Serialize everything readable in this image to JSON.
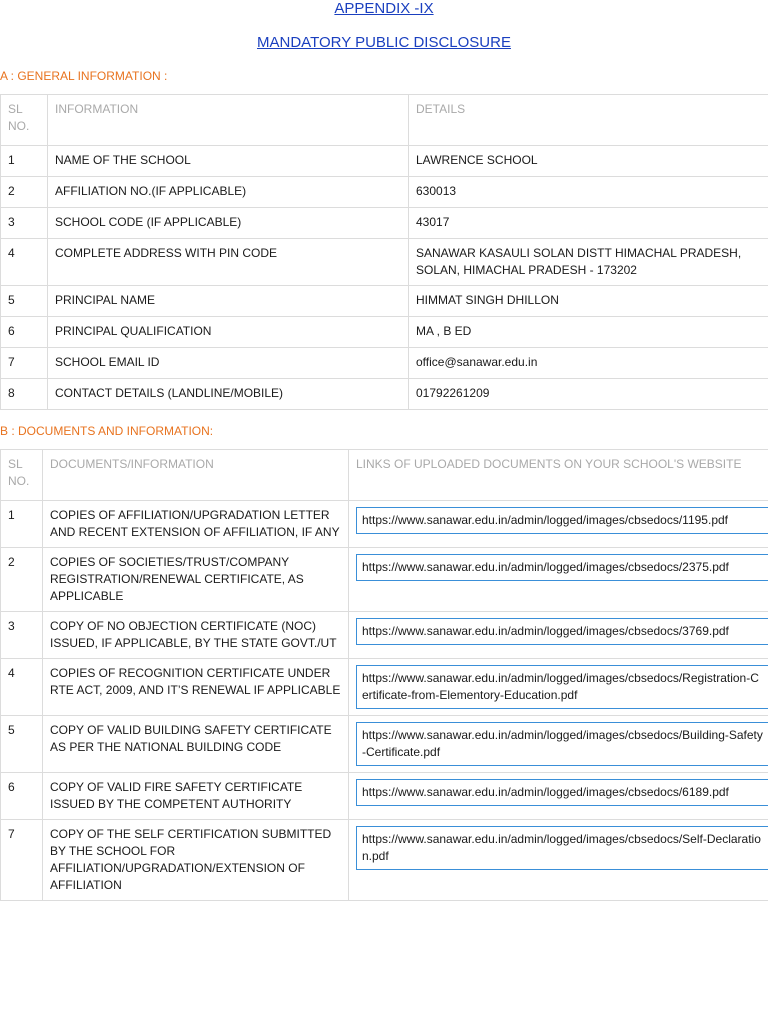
{
  "header": {
    "appendix": "APPENDIX -IX",
    "disclosure": "MANDATORY PUBLIC DISCLOSURE"
  },
  "section_a": {
    "heading": "A : GENERAL INFORMATION :",
    "columns": [
      "SL NO.",
      "INFORMATION",
      "DETAILS"
    ],
    "rows": [
      {
        "sl": "1",
        "info": "NAME OF THE SCHOOL",
        "details": "LAWRENCE SCHOOL"
      },
      {
        "sl": "2",
        "info": "AFFILIATION NO.(IF APPLICABLE)",
        "details": "630013"
      },
      {
        "sl": "3",
        "info": "SCHOOL CODE (IF APPLICABLE)",
        "details": "43017"
      },
      {
        "sl": "4",
        "info": "COMPLETE ADDRESS WITH PIN CODE",
        "details": "SANAWAR KASAULI SOLAN DISTT HIMACHAL PRADESH, SOLAN, HIMACHAL PRADESH - 173202"
      },
      {
        "sl": "5",
        "info": "PRINCIPAL NAME",
        "details": "HIMMAT SINGH DHILLON"
      },
      {
        "sl": "6",
        "info": "PRINCIPAL QUALIFICATION",
        "details": "MA , B ED"
      },
      {
        "sl": "7",
        "info": "SCHOOL EMAIL ID",
        "details": "office@sanawar.edu.in"
      },
      {
        "sl": "8",
        "info": "CONTACT DETAILS (LANDLINE/MOBILE)",
        "details": "01792261209"
      }
    ]
  },
  "section_b": {
    "heading": "B : DOCUMENTS AND INFORMATION:",
    "columns": [
      "SL NO.",
      "DOCUMENTS/INFORMATION",
      "LINKS OF UPLOADED DOCUMENTS ON YOUR SCHOOL'S WEBSITE"
    ],
    "rows": [
      {
        "sl": "1",
        "doc": "COPIES OF AFFILIATION/UPGRADATION LETTER AND RECENT EXTENSION OF AFFILIATION, IF ANY",
        "link": "https://www.sanawar.edu.in/admin/logged/images/cbsedocs/1195.pdf"
      },
      {
        "sl": "2",
        "doc": "COPIES OF SOCIETIES/TRUST/COMPANY REGISTRATION/RENEWAL CERTIFICATE, AS APPLICABLE",
        "link": "https://www.sanawar.edu.in/admin/logged/images/cbsedocs/2375.pdf"
      },
      {
        "sl": "3",
        "doc": "COPY OF NO OBJECTION CERTIFICATE (NOC) ISSUED, IF APPLICABLE, BY THE STATE GOVT./UT",
        "link": "https://www.sanawar.edu.in/admin/logged/images/cbsedocs/3769.pdf"
      },
      {
        "sl": "4",
        "doc": "COPIES OF RECOGNITION CERTIFICATE UNDER RTE ACT, 2009, AND IT’S RENEWAL IF APPLICABLE",
        "link": "https://www.sanawar.edu.in/admin/logged/images/cbsedocs/Registration-Certificate-from-Elementory-Education.pdf"
      },
      {
        "sl": "5",
        "doc": "COPY OF VALID BUILDING SAFETY CERTIFICATE AS PER THE NATIONAL BUILDING CODE",
        "link": "https://www.sanawar.edu.in/admin/logged/images/cbsedocs/Building-Safety-Certificate.pdf"
      },
      {
        "sl": "6",
        "doc": "COPY OF VALID FIRE SAFETY CERTIFICATE ISSUED BY THE COMPETENT AUTHORITY",
        "link": "https://www.sanawar.edu.in/admin/logged/images/cbsedocs/6189.pdf"
      },
      {
        "sl": "7",
        "doc": "COPY OF THE SELF CERTIFICATION SUBMITTED BY THE SCHOOL FOR AFFILIATION/UPGRADATION/EXTENSION OF AFFILIATION",
        "link": "https://www.sanawar.edu.in/admin/logged/images/cbsedocs/Self-Declaration.pdf"
      }
    ]
  },
  "colors": {
    "title_link": "#1a3fbf",
    "section_heading": "#e8731f",
    "header_text": "#a9a9a9",
    "border": "#dcdcdc",
    "link_box_border": "#3a8fd8"
  }
}
